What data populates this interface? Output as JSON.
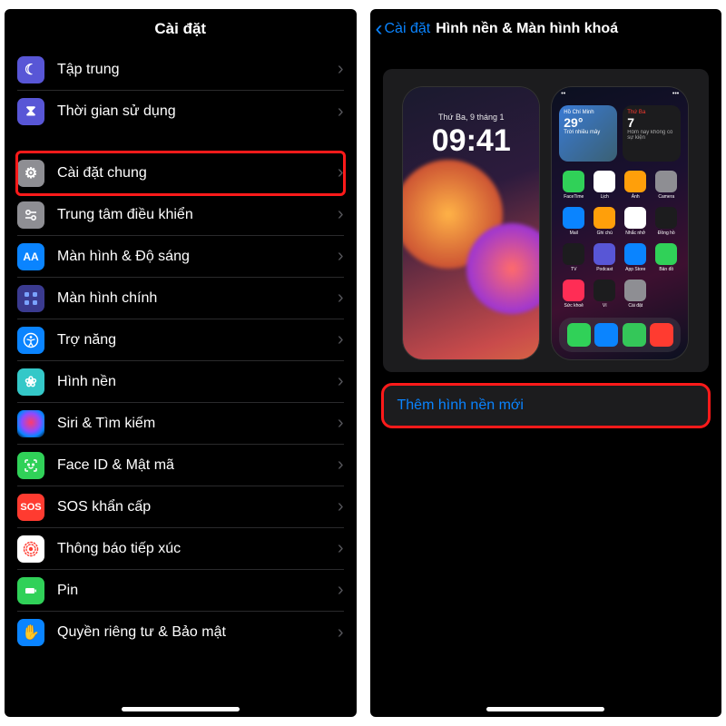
{
  "left": {
    "title": "Cài đặt",
    "group1": [
      {
        "label": "Tập trung",
        "icon": "focus"
      },
      {
        "label": "Thời gian sử dụng",
        "icon": "screen"
      }
    ],
    "group2": [
      {
        "label": "Cài đặt chung",
        "icon": "general",
        "highlight": true
      },
      {
        "label": "Trung tâm điều khiển",
        "icon": "control"
      },
      {
        "label": "Màn hình & Độ sáng",
        "icon": "display"
      },
      {
        "label": "Màn hình chính",
        "icon": "home"
      },
      {
        "label": "Trợ năng",
        "icon": "access"
      },
      {
        "label": "Hình nền",
        "icon": "wall"
      },
      {
        "label": "Siri & Tìm kiếm",
        "icon": "siri"
      },
      {
        "label": "Face ID & Mật mã",
        "icon": "faceid"
      },
      {
        "label": "SOS khẩn cấp",
        "icon": "sos"
      },
      {
        "label": "Thông báo tiếp xúc",
        "icon": "exposure"
      },
      {
        "label": "Pin",
        "icon": "battery"
      },
      {
        "label": "Quyền riêng tư & Bảo mật",
        "icon": "privacy"
      }
    ]
  },
  "right": {
    "back": "Cài đặt",
    "title": "Hình nền & Màn hình khoá",
    "lock": {
      "date": "Thứ Ba, 9 tháng 1",
      "time": "09:41"
    },
    "home_widgets": {
      "w1_city": "Hồ Chí Minh",
      "w1_temp": "29°",
      "w1_cond": "Trời nhiều mây",
      "w2_day": "Thứ Ba",
      "w2_date": "7",
      "w2_note": "Hôm nay không có sự kiện"
    },
    "apps": [
      "FaceTime",
      "Lịch",
      "Ảnh",
      "Camera",
      "Mail",
      "Ghi chú",
      "Nhắc nhở",
      "Đồng hồ",
      "TV",
      "Podcast",
      "App Store",
      "Bản đồ",
      "Sức khoẻ",
      "Ví",
      "Cài đặt",
      ""
    ],
    "add_label": "Thêm hình nền mới"
  },
  "icon_text": {
    "focus": "☾",
    "screen": "⧗",
    "general": "⚙",
    "control": "⌥",
    "display": "AA",
    "home": "▦",
    "access": "◉",
    "wall": "❀",
    "siri": "",
    "faceid": "☺",
    "sos": "SOS",
    "exposure": "⊛",
    "battery": "▮",
    "privacy": "✋"
  }
}
